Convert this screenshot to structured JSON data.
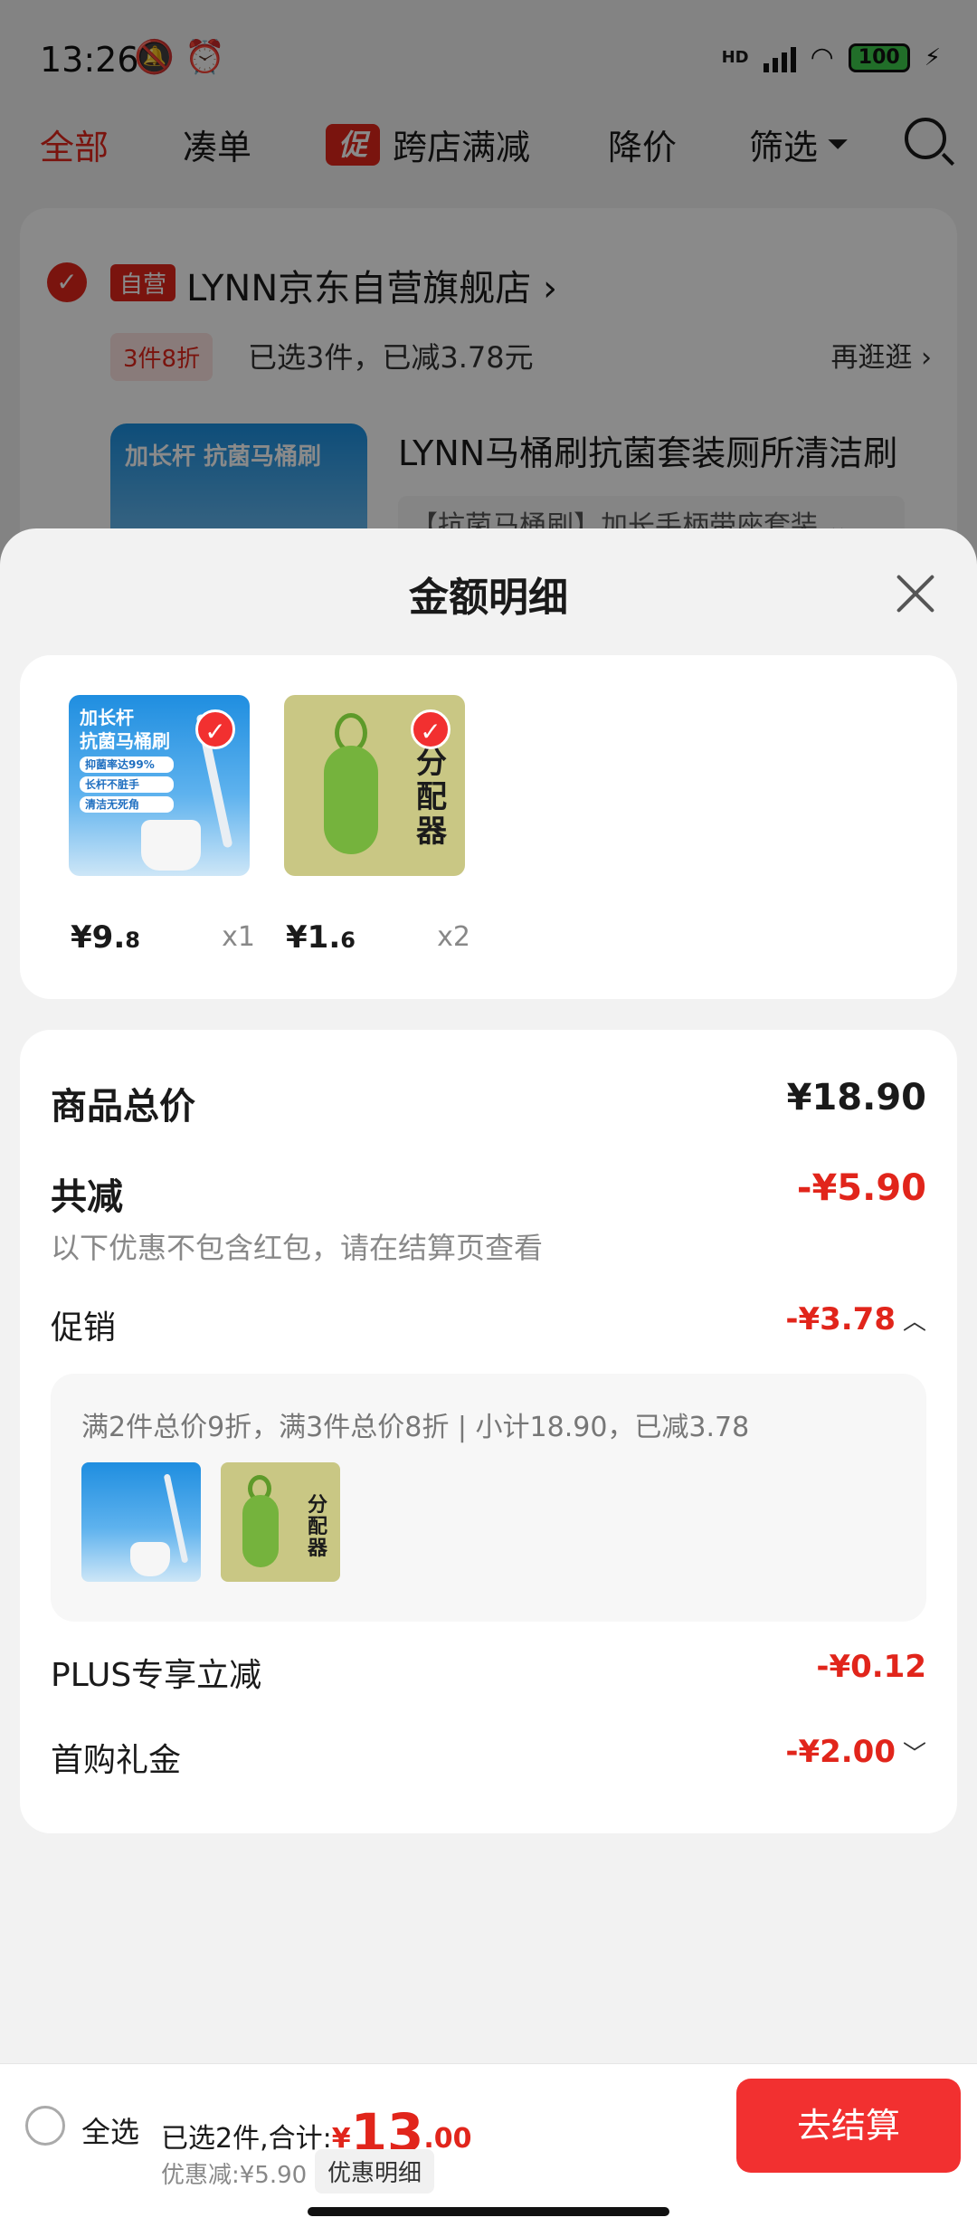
{
  "status_bar": {
    "time": "13:26",
    "network": "HD",
    "battery": "100"
  },
  "filter_bar": {
    "tabs": [
      "全部",
      "凑单",
      "跨店满减",
      "降价",
      "筛选"
    ],
    "promo_badge": "促"
  },
  "store": {
    "tag": "自营",
    "name": "LYNN京东自营旗舰店 ›",
    "deal_tag": "3件8折",
    "deal_text": "已选3件，已减3.78元",
    "more_link": "再逛逛 ›",
    "product_title": "LYNN马桶刷抗菌套装厕所清洁刷",
    "product_sku": "【抗菌马桶刷】加长手柄带座套装 ⌄",
    "thumb_text": "加长杆 抗菌马桶刷"
  },
  "sheet": {
    "title": "金额明细",
    "items": [
      {
        "price_int": "¥9.",
        "price_dec": "8",
        "qty": "x1",
        "img_title": "加长杆\n抗菌马桶刷",
        "img_points": [
          "抑菌率达99%",
          "长杆不脏手",
          "清洁无死角"
        ]
      },
      {
        "price_int": "¥1.",
        "price_dec": "6",
        "qty": "x2",
        "img_title": "分配器"
      }
    ],
    "total_label": "商品总价",
    "total_value": "¥18.90",
    "reduce_label": "共减",
    "reduce_value": "-¥5.90",
    "reduce_note": "以下优惠不包含红包，请在结算页查看",
    "promo_label": "促销",
    "promo_value": "-¥3.78",
    "promo_desc": "满2件总价9折，满3件总价8折 | 小计18.90，已减3.78",
    "plus_label": "PLUS专享立减",
    "plus_value": "-¥0.12",
    "gift_label": "首购礼金",
    "gift_value": "-¥2.00"
  },
  "bottom_bar": {
    "select_all": "全选",
    "selected_prefix": "已选2件,合计:",
    "total_yen": "¥",
    "total_int": "13",
    "total_dec": ".00",
    "discount_text": "优惠减:¥5.90",
    "discount_chip": "优惠明细",
    "checkout": "去结算"
  },
  "colors": {
    "accent": "#e1251b",
    "checkout_bg": "#f23030",
    "sheet_bg": "#f2f2f2"
  }
}
